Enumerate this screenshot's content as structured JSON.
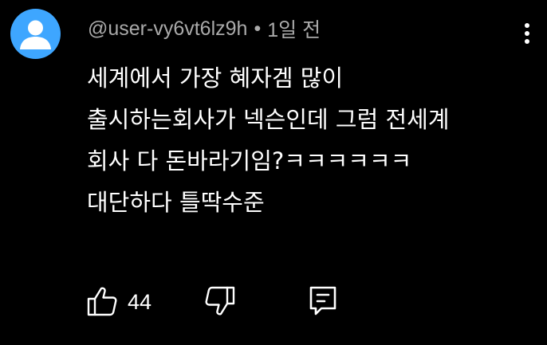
{
  "comment": {
    "author": "@user-vy6vt6lz9h",
    "separator": "•",
    "time": "1일 전",
    "lines": [
      "세계에서 가장 혜자겜 많이",
      "출시하는회사가 넥슨인데 그럼 전세계",
      "회사 다 돈바라기임?ㅋㅋㅋㅋㅋㅋ",
      "대단하다 틀딱수준"
    ],
    "like_count": "44"
  },
  "icons": {
    "avatar": "default-user-avatar-icon",
    "menu": "more-vertical-icon",
    "like": "thumbs-up-icon",
    "dislike": "thumbs-down-icon",
    "reply": "comment-reply-icon"
  },
  "colors": {
    "background": "#000000",
    "text": "#ffffff",
    "secondary_text": "#aaaaaa",
    "avatar_bg": "#3ea6ff"
  }
}
